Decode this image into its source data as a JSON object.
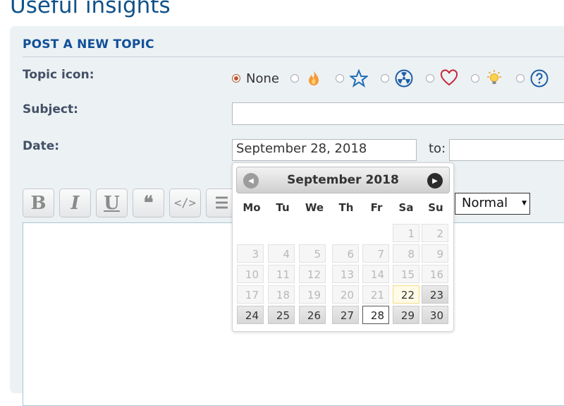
{
  "page": {
    "title": "Useful insights"
  },
  "form": {
    "heading": "POST A NEW TOPIC",
    "topic_icon_label": "Topic icon:",
    "none_option_label": "None",
    "topic_icons": [
      "flame-icon",
      "star-icon",
      "radiation-icon",
      "heart-icon",
      "lightbulb-icon",
      "question-icon"
    ],
    "subject_label": "Subject:",
    "subject_value": "",
    "date_label": "Date:",
    "date_value": "September 28, 2018",
    "to_label": "to:",
    "to_value": "",
    "font_size_value": "Normal"
  },
  "toolbar": {
    "bold": "B",
    "italic": "I",
    "underline": "U",
    "quote": "❝",
    "code": "</>",
    "list": "☰"
  },
  "calendar": {
    "title": "September 2018",
    "weekdays": [
      "Mo",
      "Tu",
      "We",
      "Th",
      "Fr",
      "Sa",
      "Su"
    ],
    "weeks": [
      [
        "",
        "",
        "",
        "",
        "",
        "1",
        "2"
      ],
      [
        "3",
        "4",
        "5",
        "6",
        "7",
        "8",
        "9"
      ],
      [
        "10",
        "11",
        "12",
        "13",
        "14",
        "15",
        "16"
      ],
      [
        "17",
        "18",
        "19",
        "20",
        "21",
        "22",
        "23"
      ],
      [
        "24",
        "25",
        "26",
        "27",
        "28",
        "29",
        "30"
      ]
    ],
    "today": "22",
    "selected": "28",
    "first_enabled": "22"
  },
  "colors": {
    "brand": "#105289",
    "heading": "#115098",
    "panel": "#ecf1f3"
  }
}
